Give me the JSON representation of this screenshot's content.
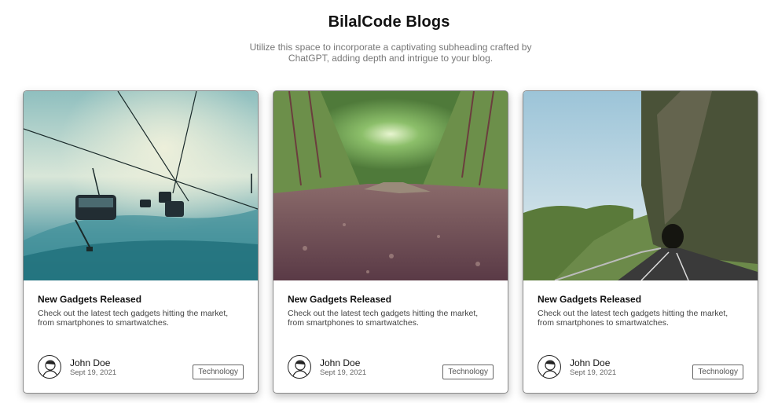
{
  "header": {
    "title": "BilalCode Blogs",
    "subtitle": "Utilize this space to incorporate a captivating subheading crafted by ChatGPT, adding depth and intrigue to your blog."
  },
  "cards": [
    {
      "image": "ski-lift-in-fog",
      "title": "New Gadgets Released",
      "description": "Check out the latest tech gadgets hitting the market, from smartphones to smartwatches.",
      "author": "John Doe",
      "date": "Sept 19, 2021",
      "tag": "Technology"
    },
    {
      "image": "forest-tree-tunnel-path",
      "title": "New Gadgets Released",
      "description": "Check out the latest tech gadgets hitting the market, from smartphones to smartwatches.",
      "author": "John Doe",
      "date": "Sept 19, 2021",
      "tag": "Technology"
    },
    {
      "image": "mountain-road-tunnel",
      "title": "New Gadgets Released",
      "description": "Check out the latest tech gadgets hitting the market, from smartphones to smartwatches.",
      "author": "John Doe",
      "date": "Sept 19, 2021",
      "tag": "Technology"
    }
  ],
  "icons": {
    "avatar": "avatar-icon"
  }
}
